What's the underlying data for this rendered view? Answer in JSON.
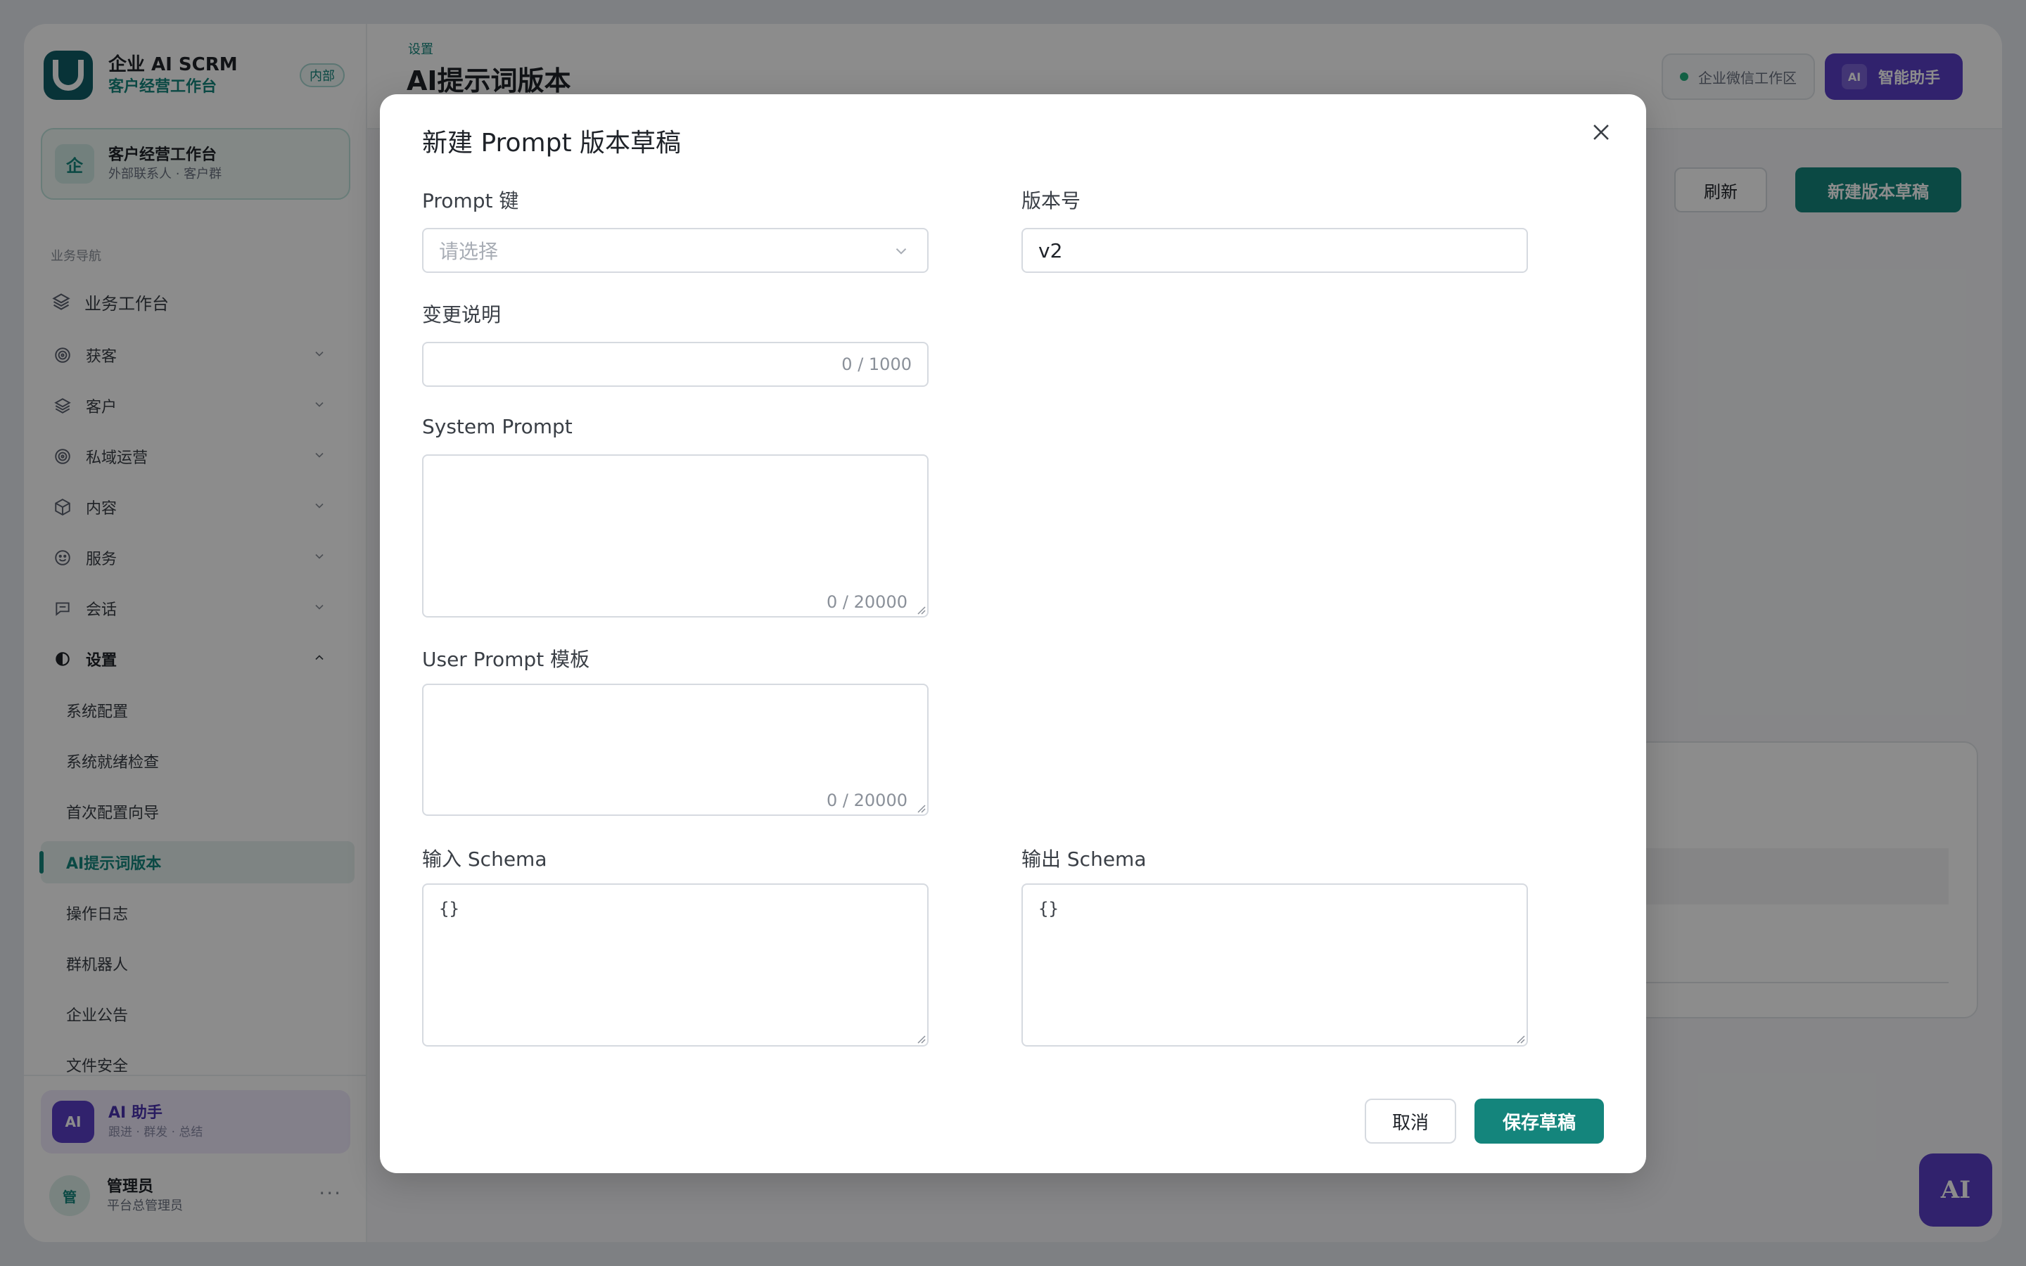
{
  "brand": {
    "name": "企业 AI SCRM",
    "subtitle": "客户经营工作台",
    "tag": "内部"
  },
  "workspace": {
    "avatar": "企",
    "title": "客户经营工作台",
    "subtitle": "外部联系人 · 客户群"
  },
  "sidebar": {
    "section_label": "业务导航",
    "top_item": "业务工作台",
    "groups": [
      {
        "label": "获客",
        "icon": "target-icon"
      },
      {
        "label": "客户",
        "icon": "layers-icon"
      },
      {
        "label": "私域运营",
        "icon": "target-icon"
      },
      {
        "label": "内容",
        "icon": "cube-icon"
      },
      {
        "label": "服务",
        "icon": "smile-icon"
      },
      {
        "label": "会话",
        "icon": "chat-icon"
      },
      {
        "label": "设置",
        "icon": "settings-icon"
      }
    ],
    "settings_items": [
      "系统配置",
      "系统就绪检查",
      "首次配置向导",
      "AI提示词版本",
      "操作日志",
      "群机器人",
      "企业公告",
      "文件安全"
    ],
    "ai_card": {
      "avatar": "AI",
      "title": "AI 助手",
      "subtitle": "跟进 · 群发 · 总结"
    },
    "user": {
      "avatar": "管",
      "name": "管理员",
      "role": "平台总管理员",
      "more": "···"
    }
  },
  "header": {
    "breadcrumb": "设置",
    "title": "AI提示词版本",
    "workspace_pill": "企业微信工作区",
    "assistant_tag": "AI",
    "assistant_label": "智能助手"
  },
  "toolbar": {
    "refresh": "刷新",
    "new_draft": "新建版本草稿"
  },
  "modal": {
    "title": "新建 Prompt 版本草稿",
    "prompt_key": {
      "label": "Prompt 键",
      "placeholder": "请选择"
    },
    "version": {
      "label": "版本号",
      "value": "v2"
    },
    "change_note": {
      "label": "变更说明",
      "counter": "0 / 1000"
    },
    "system_prompt": {
      "label": "System Prompt",
      "counter": "0 / 20000"
    },
    "user_prompt": {
      "label": "User Prompt 模板",
      "counter": "0 / 20000"
    },
    "input_schema": {
      "label": "输入 Schema",
      "value": "{}"
    },
    "output_schema": {
      "label": "输出 Schema",
      "value": "{}"
    },
    "cancel": "取消",
    "save": "保存草稿"
  },
  "fab": {
    "label": "AI"
  },
  "colors": {
    "primary": "#14857c",
    "accent": "#5a3fc7",
    "overlay": "rgba(0,0,0,0.45)"
  }
}
